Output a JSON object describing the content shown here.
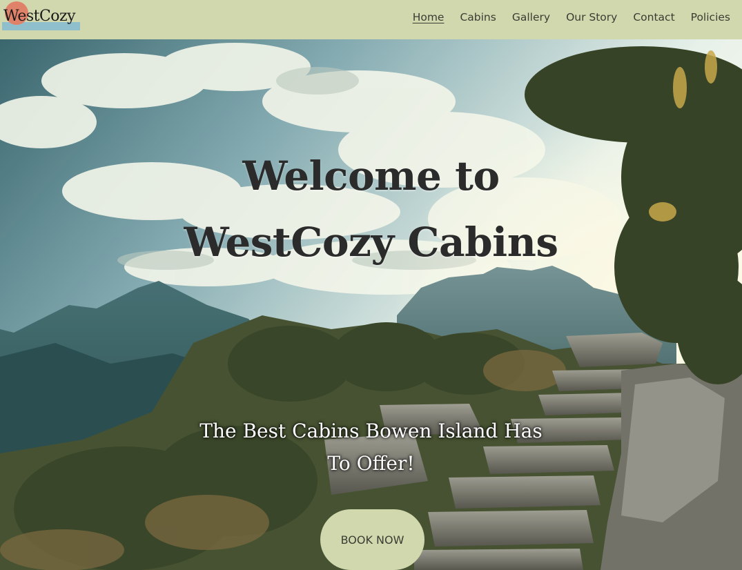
{
  "brand": {
    "logo_text": "WestCozy",
    "colors": {
      "nav_bg": "#d1d8ae",
      "logo_circle": "#e0826a",
      "logo_bar": "#8fbfcd",
      "button_bg": "#d1d8ae"
    }
  },
  "nav": {
    "items": [
      {
        "label": "Home",
        "active": true
      },
      {
        "label": "Cabins"
      },
      {
        "label": "Gallery"
      },
      {
        "label": "Our Story"
      },
      {
        "label": "Contact"
      },
      {
        "label": "Policies"
      }
    ]
  },
  "hero": {
    "title_line1": "Welcome to",
    "title_line2": "WestCozy Cabins",
    "subtitle_line1": "The Best Cabins Bowen Island Has",
    "subtitle_line2": "To Offer!",
    "cta_label": "BOOK NOW",
    "background": "mountain-trail-photo"
  }
}
